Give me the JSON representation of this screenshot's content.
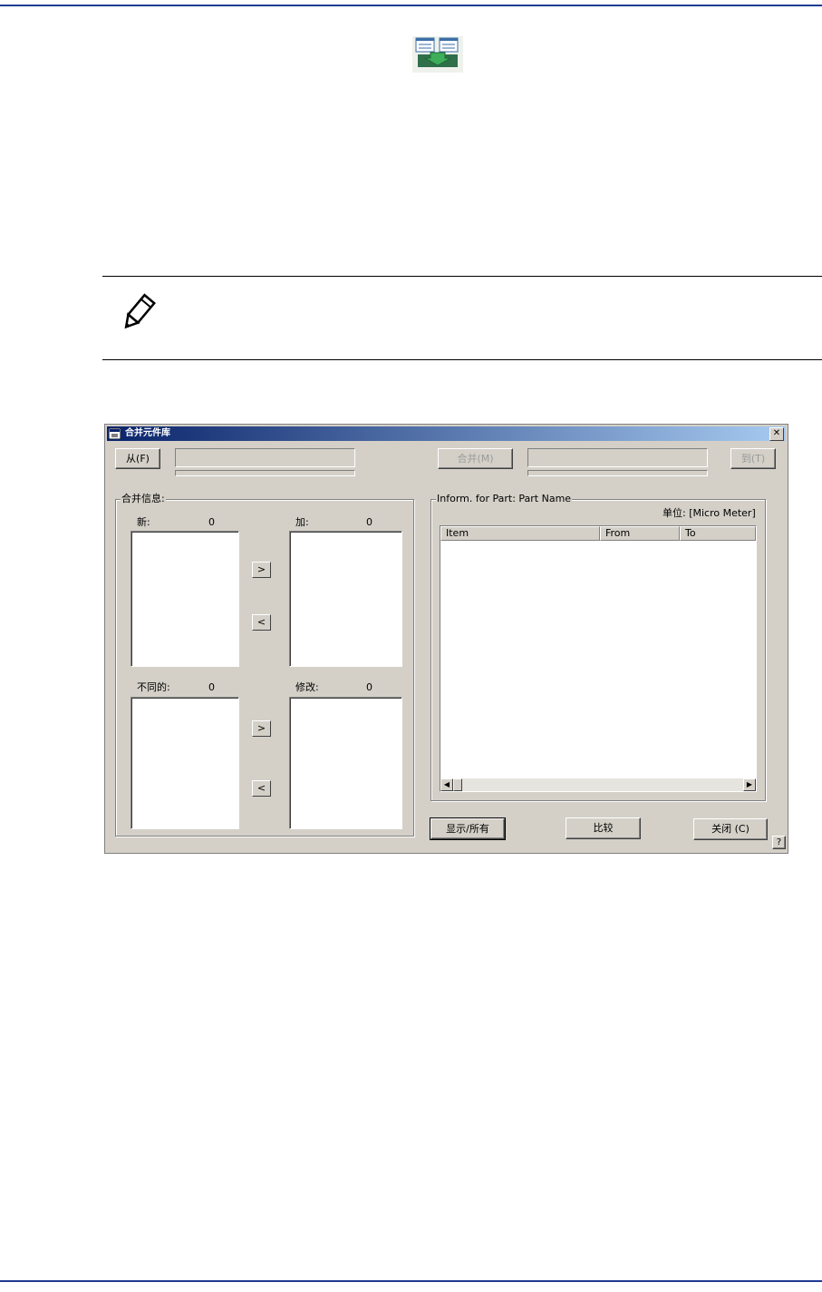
{
  "dialog": {
    "title": "合并元件库",
    "close_glyph": "✕",
    "from_button": "从(F)",
    "merge_button": "合并(M)",
    "to_button": "到(T)",
    "merge_info_group": "合并信息:",
    "new_label": "新:",
    "new_count": "0",
    "add_label": "加:",
    "add_count": "0",
    "diff_label": "不同的:",
    "diff_count": "0",
    "modify_label": "修改:",
    "modify_count": "0",
    "move_right": ">",
    "move_left": "<",
    "inform_group": "Inform. for Part: Part Name",
    "unit_label": "单位: [Micro Meter]",
    "columns": [
      "Item",
      "From",
      "To"
    ],
    "show_all_button": "显示/所有",
    "compare_button": "比较",
    "close_button": "关闭 (C)",
    "help_button": "?"
  }
}
